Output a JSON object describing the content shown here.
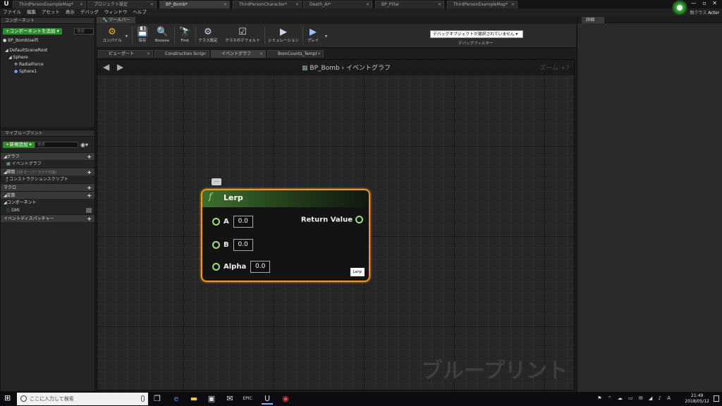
{
  "titlebar": {
    "logo": "U",
    "tabs": [
      "ThirdPersonExampleMap*",
      "プロジェクト設定",
      "BP_Bomb*",
      "ThirdPersonCharacter*",
      "Death_AI*",
      "BP_Pillar",
      "ThirdPersonExampleMap*"
    ],
    "window_buttons": "— ▫ ✕"
  },
  "menu": [
    "ファイル",
    "編集",
    "アセット",
    "表示",
    "デバッグ",
    "ウィンドウ",
    "ヘルプ"
  ],
  "parent_class": {
    "label": "親クラス",
    "value": "Actor"
  },
  "components_panel": {
    "tab": "コンポーネント",
    "add_button": "+コンポーネントを追加 ▾",
    "search_placeholder": "検索",
    "self_item": "BP_Bomb(self)",
    "tree": [
      "DefaultSceneRoot",
      "Sphere",
      "RadialForce",
      "Sphere1"
    ]
  },
  "myblueprint_panel": {
    "tab": "マイブループリント",
    "add_button": "+新規追加 ▾",
    "search_placeholder": "検索",
    "sections": {
      "graph": "グラフ",
      "event_graph": "イベントグラフ",
      "functions": "関数",
      "functions_note": "(18 オーバーライド可能)",
      "construction_script": "コンストラクションスクリプト",
      "macros": "マクロ",
      "variables": "変数",
      "components": "コンポーネント",
      "dmi": "DMI",
      "dispatchers": "イベントディスパッチャー"
    }
  },
  "toolbar": {
    "tab": "ツールバー",
    "buttons": [
      "コンパイル",
      "保存",
      "Browse",
      "Find",
      "クラス設定",
      "クラスのデフォルト",
      "シミュレーション",
      "プレイ"
    ],
    "debug_select": "デバッグオブジェクトが選択されていません ▾",
    "debug_filter": "デバッグフィルター"
  },
  "editor_tabs": [
    "ビューポート",
    "Construction Scrip",
    "イベントグラフ",
    "BomCounts_Templ"
  ],
  "graph": {
    "breadcrumb_bp": "BP_Bomb",
    "breadcrumb_sep": "›",
    "breadcrumb_graph": "イベントグラフ",
    "zoom": "ズーム +7",
    "watermark": "ブループリント",
    "comment_bubble": "..."
  },
  "node": {
    "glyph": "f",
    "title": "Lerp",
    "inputs": [
      {
        "label": "A",
        "value": "0.0"
      },
      {
        "label": "B",
        "value": "0.0"
      },
      {
        "label": "Alpha",
        "value": "0.0"
      }
    ],
    "output": "Return Value",
    "tag": "Lerp"
  },
  "details_panel": {
    "tab": "詳細"
  },
  "taskbar": {
    "search_placeholder": "ここに入力して検索",
    "time": "21:49",
    "date": "2018/05/12"
  },
  "colors": {
    "node_border": "#f19a12",
    "pin": "#9be07a",
    "add_button": "#2e8b2e"
  }
}
